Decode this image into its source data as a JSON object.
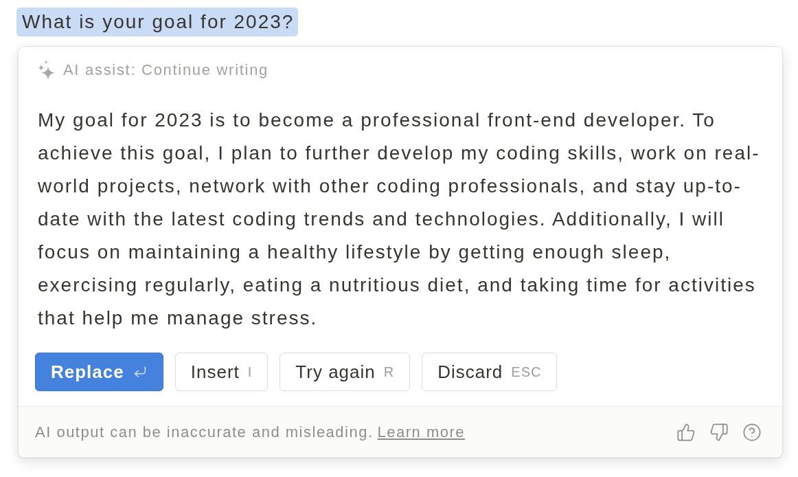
{
  "heading": {
    "text": "What is your goal for 2023?",
    "selected": true
  },
  "assist": {
    "label": "AI assist: Continue writing",
    "response": "My goal for 2023 is to become a professional front-end developer. To achieve this goal, I plan to further develop my coding skills, work on real-world projects, network with other coding professionals, and stay up-to-date with the latest coding trends and technologies. Additionally, I will focus on maintaining a healthy lifestyle by getting enough sleep, exercising regularly, eating a nutritious diet, and taking time for activities that help me manage stress."
  },
  "actions": [
    {
      "kind": "primary",
      "label": "Replace"
    },
    {
      "kind": "secondary",
      "label": "Insert",
      "shortcut": "I"
    },
    {
      "kind": "secondary",
      "label": "Try again",
      "shortcut": "R"
    },
    {
      "kind": "secondary",
      "label": "Discard",
      "shortcut": "ESC"
    }
  ],
  "footer": {
    "disclaimer": "AI output can be inaccurate and misleading.",
    "link": "Learn more"
  }
}
